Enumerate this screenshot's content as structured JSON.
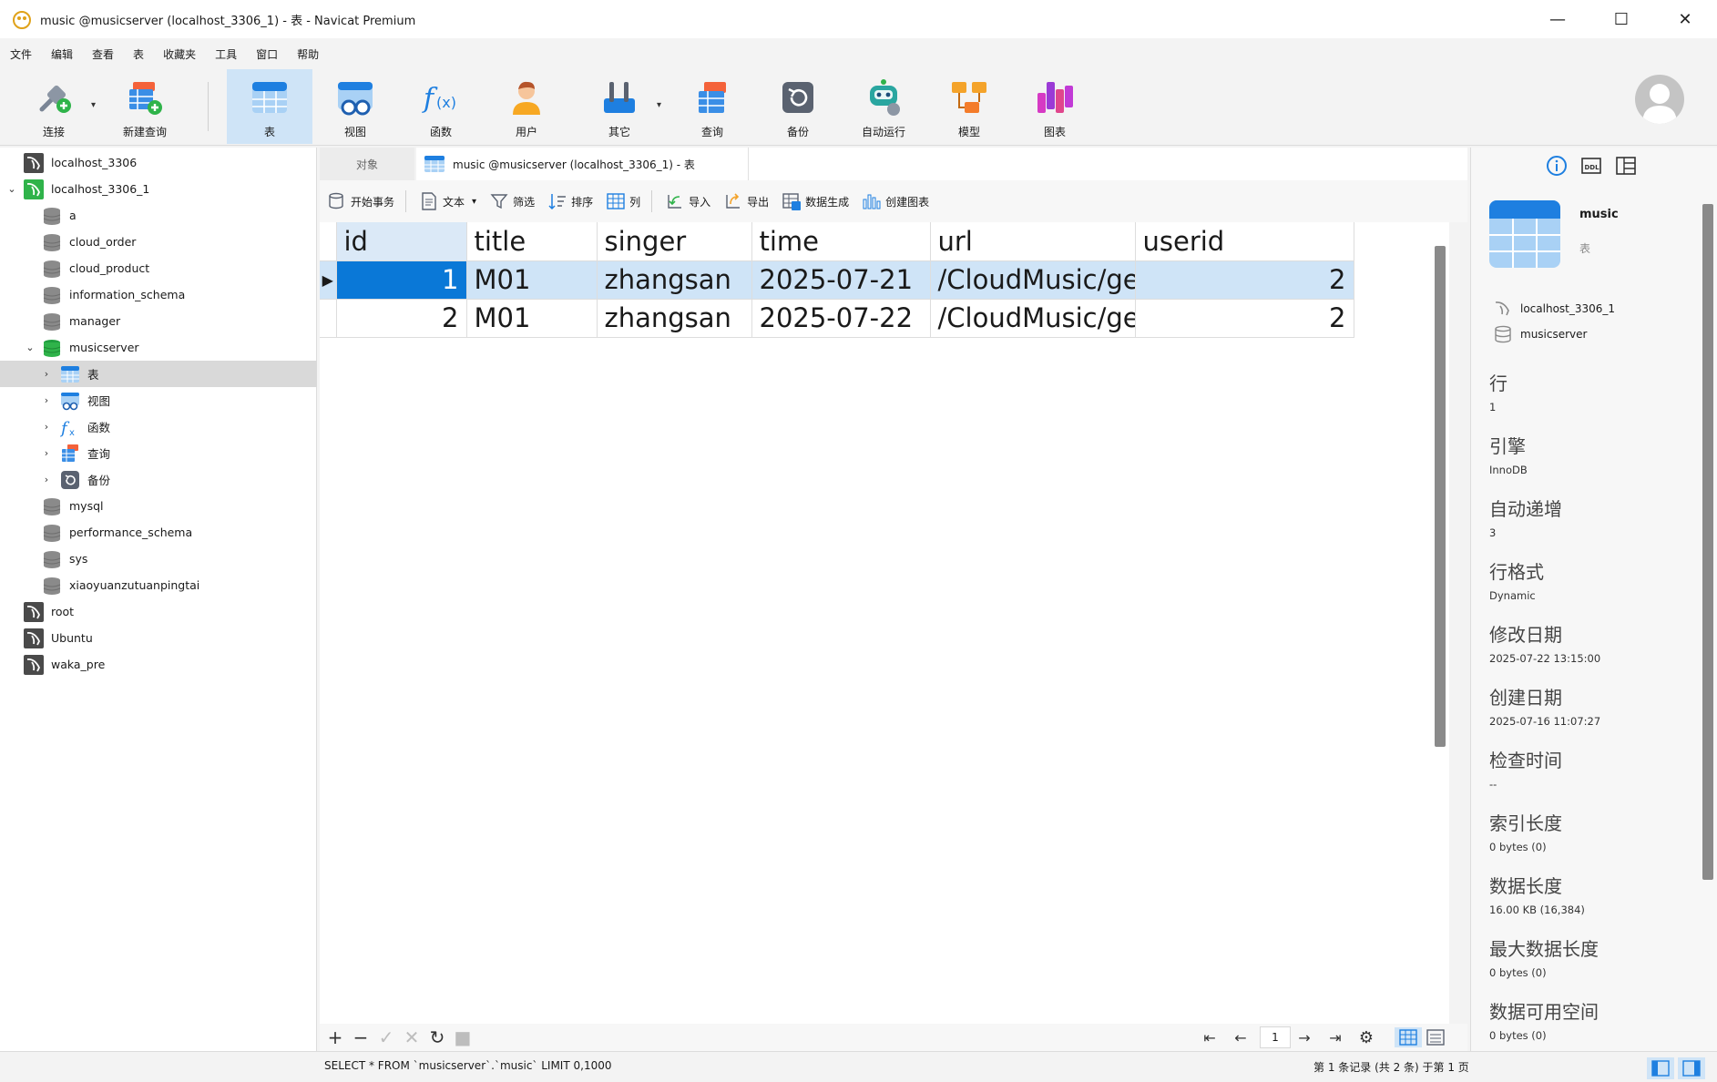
{
  "window": {
    "title": "music @musicserver (localhost_3306_1) - 表 - Navicat Premium",
    "minimize": "—",
    "maximize": "☐",
    "close": "✕"
  },
  "menu": [
    "文件",
    "编辑",
    "查看",
    "表",
    "收藏夹",
    "工具",
    "窗口",
    "帮助"
  ],
  "toolbar": {
    "connect": "连接",
    "new_query": "新建查询",
    "table": "表",
    "view": "视图",
    "function": "函数",
    "user": "用户",
    "other": "其它",
    "query": "查询",
    "backup": "备份",
    "automation": "自动运行",
    "model": "模型",
    "chart": "图表"
  },
  "sidebar": {
    "connections": [
      {
        "label": "localhost_3306"
      },
      {
        "label": "localhost_3306_1"
      },
      {
        "label": "root"
      },
      {
        "label": "Ubuntu"
      },
      {
        "label": "waka_pre"
      }
    ],
    "databases": [
      "a",
      "cloud_order",
      "cloud_product",
      "information_schema",
      "manager",
      "musicserver",
      "mysql",
      "performance_schema",
      "sys",
      "xiaoyuanzutuanpingtai"
    ],
    "musicserver_children": [
      "表",
      "视图",
      "函数",
      "查询",
      "备份"
    ]
  },
  "tabs": {
    "objects": "对象",
    "active": "music @musicserver (localhost_3306_1) - 表"
  },
  "subtoolbar": {
    "begin_transaction": "开始事务",
    "text": "文本",
    "filter": "筛选",
    "sort": "排序",
    "columns": "列",
    "import": "导入",
    "export": "导出",
    "data_generation": "数据生成",
    "create_chart": "创建图表"
  },
  "grid": {
    "columns": [
      "id",
      "title",
      "singer",
      "time",
      "url",
      "userid"
    ],
    "rows": [
      [
        "1",
        "M01",
        "zhangsan",
        "2025-07-21",
        "/CloudMusic/ge",
        "2"
      ],
      [
        "2",
        "M01",
        "zhangsan",
        "2025-07-22",
        "/CloudMusic/ge",
        "2"
      ]
    ]
  },
  "pager": {
    "page": "1"
  },
  "info_panel": {
    "name": "music",
    "type": "表",
    "connection": "localhost_3306_1",
    "database": "musicserver",
    "props": [
      {
        "k": "行",
        "v": "1"
      },
      {
        "k": "引擎",
        "v": "InnoDB"
      },
      {
        "k": "自动递增",
        "v": "3"
      },
      {
        "k": "行格式",
        "v": "Dynamic"
      },
      {
        "k": "修改日期",
        "v": "2025-07-22 13:15:00"
      },
      {
        "k": "创建日期",
        "v": "2025-07-16 11:07:27"
      },
      {
        "k": "检查时间",
        "v": "--"
      },
      {
        "k": "索引长度",
        "v": "0 bytes (0)"
      },
      {
        "k": "数据长度",
        "v": "16.00 KB (16,384)"
      },
      {
        "k": "最大数据长度",
        "v": "0 bytes (0)"
      },
      {
        "k": "数据可用空间",
        "v": "0 bytes (0)"
      }
    ]
  },
  "status": {
    "sql": "SELECT * FROM `musicserver`.`music` LIMIT 0,1000",
    "records": "第 1 条记录 (共 2 条) 于第 1 页"
  },
  "colors": {
    "accent": "#0a78d7",
    "selection": "#cfe4f7",
    "sidebar_selected": "#d9d9d9"
  }
}
